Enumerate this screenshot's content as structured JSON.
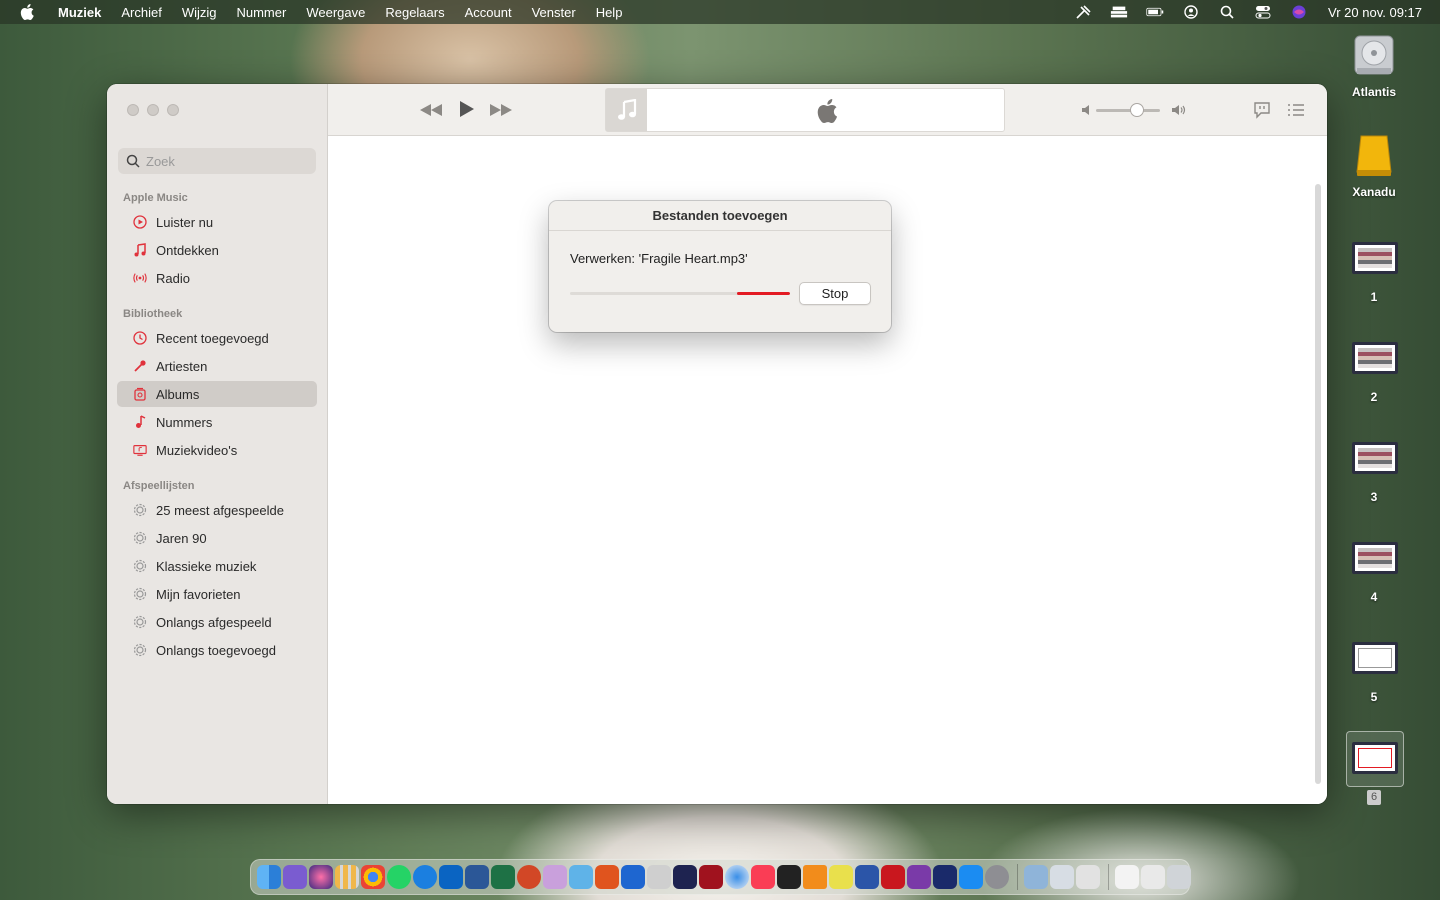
{
  "menubar": {
    "app_name": "Muziek",
    "items": [
      "Archief",
      "Wijzig",
      "Nummer",
      "Weergave",
      "Regelaars",
      "Account",
      "Venster",
      "Help"
    ],
    "clock": "Vr 20 nov.  09:17"
  },
  "sidebar": {
    "search_placeholder": "Zoek",
    "sections": {
      "apple_music": "Apple Music",
      "library": "Bibliotheek",
      "playlists": "Afspeellijsten"
    },
    "apple_music_items": [
      "Luister nu",
      "Ontdekken",
      "Radio"
    ],
    "library_items": [
      "Recent toegevoegd",
      "Artiesten",
      "Albums",
      "Nummers",
      "Muziekvideo's"
    ],
    "playlist_items": [
      "25 meest afgespeelde",
      "Jaren 90",
      "Klassieke muziek",
      "Mijn favorieten",
      "Onlangs afgespeeld",
      "Onlangs toegevoegd"
    ],
    "selected": "Albums"
  },
  "dialog": {
    "title": "Bestanden toevoegen",
    "message": "Verwerken: 'Fragile Heart.mp3'",
    "progress_fraction": 0.24,
    "stop_label": "Stop"
  },
  "desktop": {
    "volumes": [
      "Atlantis",
      "Xanadu"
    ],
    "spaces": [
      "1",
      "2",
      "3",
      "4",
      "5",
      "6"
    ]
  },
  "colors": {
    "accent_red": "#e31b23",
    "sidebar_icon": "#e0323c"
  }
}
